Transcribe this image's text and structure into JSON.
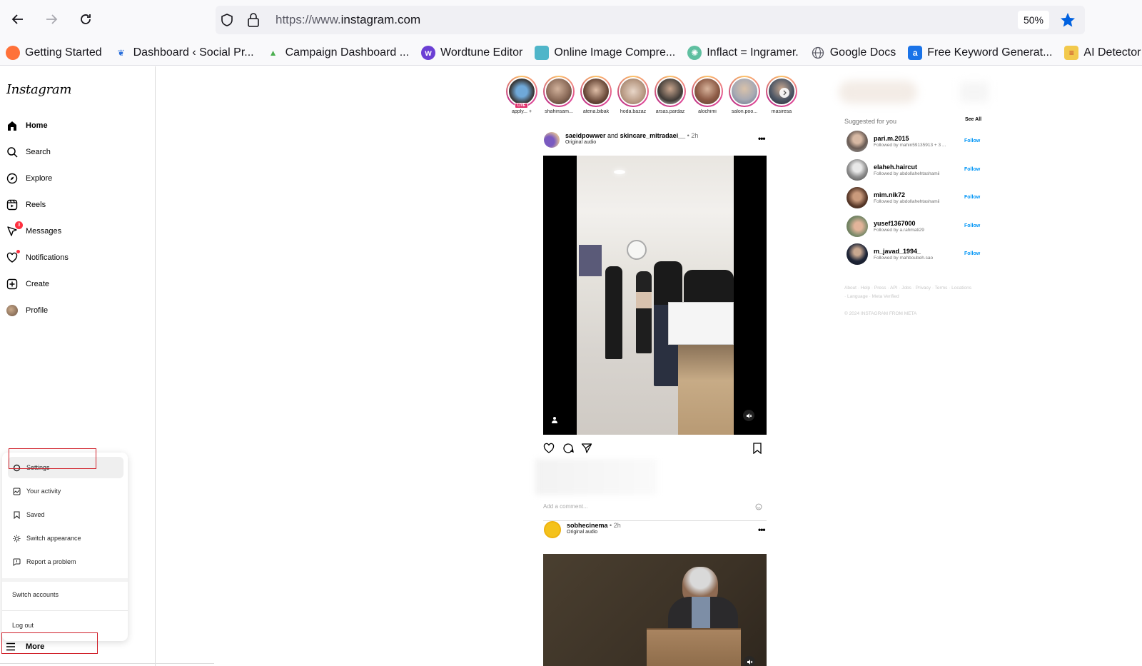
{
  "browser": {
    "url_scheme": "https://www.",
    "url_host": "instagram.com",
    "zoom": "50%",
    "bookmarks": [
      {
        "label": "Getting Started",
        "icon": "firefox-icon",
        "color": "#ff7139"
      },
      {
        "label": "Dashboard ‹ Social Pr...",
        "icon": "social-pr-icon",
        "color": "#2a6fdb"
      },
      {
        "label": "Campaign Dashboard ...",
        "icon": "campaign-icon",
        "color": "#4caf50"
      },
      {
        "label": "Wordtune Editor",
        "icon": "wordtune-icon",
        "color": "#6b3fd4"
      },
      {
        "label": "Online Image Compre...",
        "icon": "image-compress-icon",
        "color": "#4fb5c9"
      },
      {
        "label": "Inflact = Ingramer.",
        "icon": "inflact-icon",
        "color": "#5fbfa0"
      },
      {
        "label": "Google Docs",
        "icon": "globe-icon",
        "color": "#5b5b66"
      },
      {
        "label": "Free Keyword Generat...",
        "icon": "keyword-icon",
        "color": "#1a73e8"
      },
      {
        "label": "AI Detector by C",
        "icon": "ai-detector-icon",
        "color": "#f2c94c"
      }
    ]
  },
  "app": {
    "logo": "Instagram",
    "nav": [
      {
        "label": "Home",
        "icon": "home-icon",
        "active": true
      },
      {
        "label": "Search",
        "icon": "search-icon"
      },
      {
        "label": "Explore",
        "icon": "explore-icon"
      },
      {
        "label": "Reels",
        "icon": "reels-icon"
      },
      {
        "label": "Messages",
        "icon": "messages-icon",
        "badge": "3"
      },
      {
        "label": "Notifications",
        "icon": "heart-icon"
      },
      {
        "label": "Create",
        "icon": "create-icon"
      },
      {
        "label": "Profile",
        "icon": "profile-avatar"
      }
    ],
    "more_menu": {
      "items": [
        {
          "label": "Settings",
          "icon": "settings-icon"
        },
        {
          "label": "Your activity",
          "icon": "activity-icon"
        },
        {
          "label": "Saved",
          "icon": "bookmark-icon"
        },
        {
          "label": "Switch appearance",
          "icon": "sun-icon"
        },
        {
          "label": "Report a problem",
          "icon": "report-icon"
        }
      ],
      "switch_accounts": "Switch accounts",
      "log_out": "Log out"
    },
    "more_label": "More"
  },
  "stories": [
    {
      "name": "apply... +",
      "live": "LIVE",
      "color": "#3a3a3a"
    },
    {
      "name": "shahinsam...",
      "color": "#8a6a58"
    },
    {
      "name": "atena.bibak",
      "color": "#6b4a3a"
    },
    {
      "name": "hoda.bazaz",
      "color": "#b89a84"
    },
    {
      "name": "arsas.pardaz",
      "color": "#3e3a36"
    },
    {
      "name": "alochimi",
      "color": "#8d5b46"
    },
    {
      "name": "salon.poo...",
      "color": "#a7a9b3"
    },
    {
      "name": "masiresa",
      "color": "#4f5866"
    }
  ],
  "posts": [
    {
      "user": "saeidpowwer",
      "and": "and",
      "collab": "skincare_mitradaei__",
      "time": "• 2h",
      "audio": "Original audio",
      "comment_placeholder": "Add a comment..."
    },
    {
      "user": "sobhecinema",
      "time": "• 2h",
      "audio": "Original audio"
    }
  ],
  "suggestions": {
    "title": "Suggested for you",
    "see_all": "See All",
    "follow_label": "Follow",
    "items": [
      {
        "username": "pari.m.2015",
        "followed_by": "Followed by mahin59135913 + 3 ...",
        "color": "#6a5c55"
      },
      {
        "username": "elaheh.haircut",
        "followed_by": "Followed by abdollahehtashamii",
        "color": "#8f8f8f"
      },
      {
        "username": "mim.nik72",
        "followed_by": "Followed by abdollahehtashamii",
        "color": "#5a3a2a"
      },
      {
        "username": "yusef1367000",
        "followed_by": "Followed by a.rahmati29",
        "color": "#7b8a6a"
      },
      {
        "username": "m_javad_1994_",
        "followed_by": "Followed by mahboubeh.sao",
        "color": "#1f2638"
      }
    ]
  },
  "footer": {
    "links": "About · Help · Press · API · Jobs · Privacy · Terms · Locations · Language · Meta Verified",
    "copyright": "© 2024 INSTAGRAM FROM META"
  }
}
